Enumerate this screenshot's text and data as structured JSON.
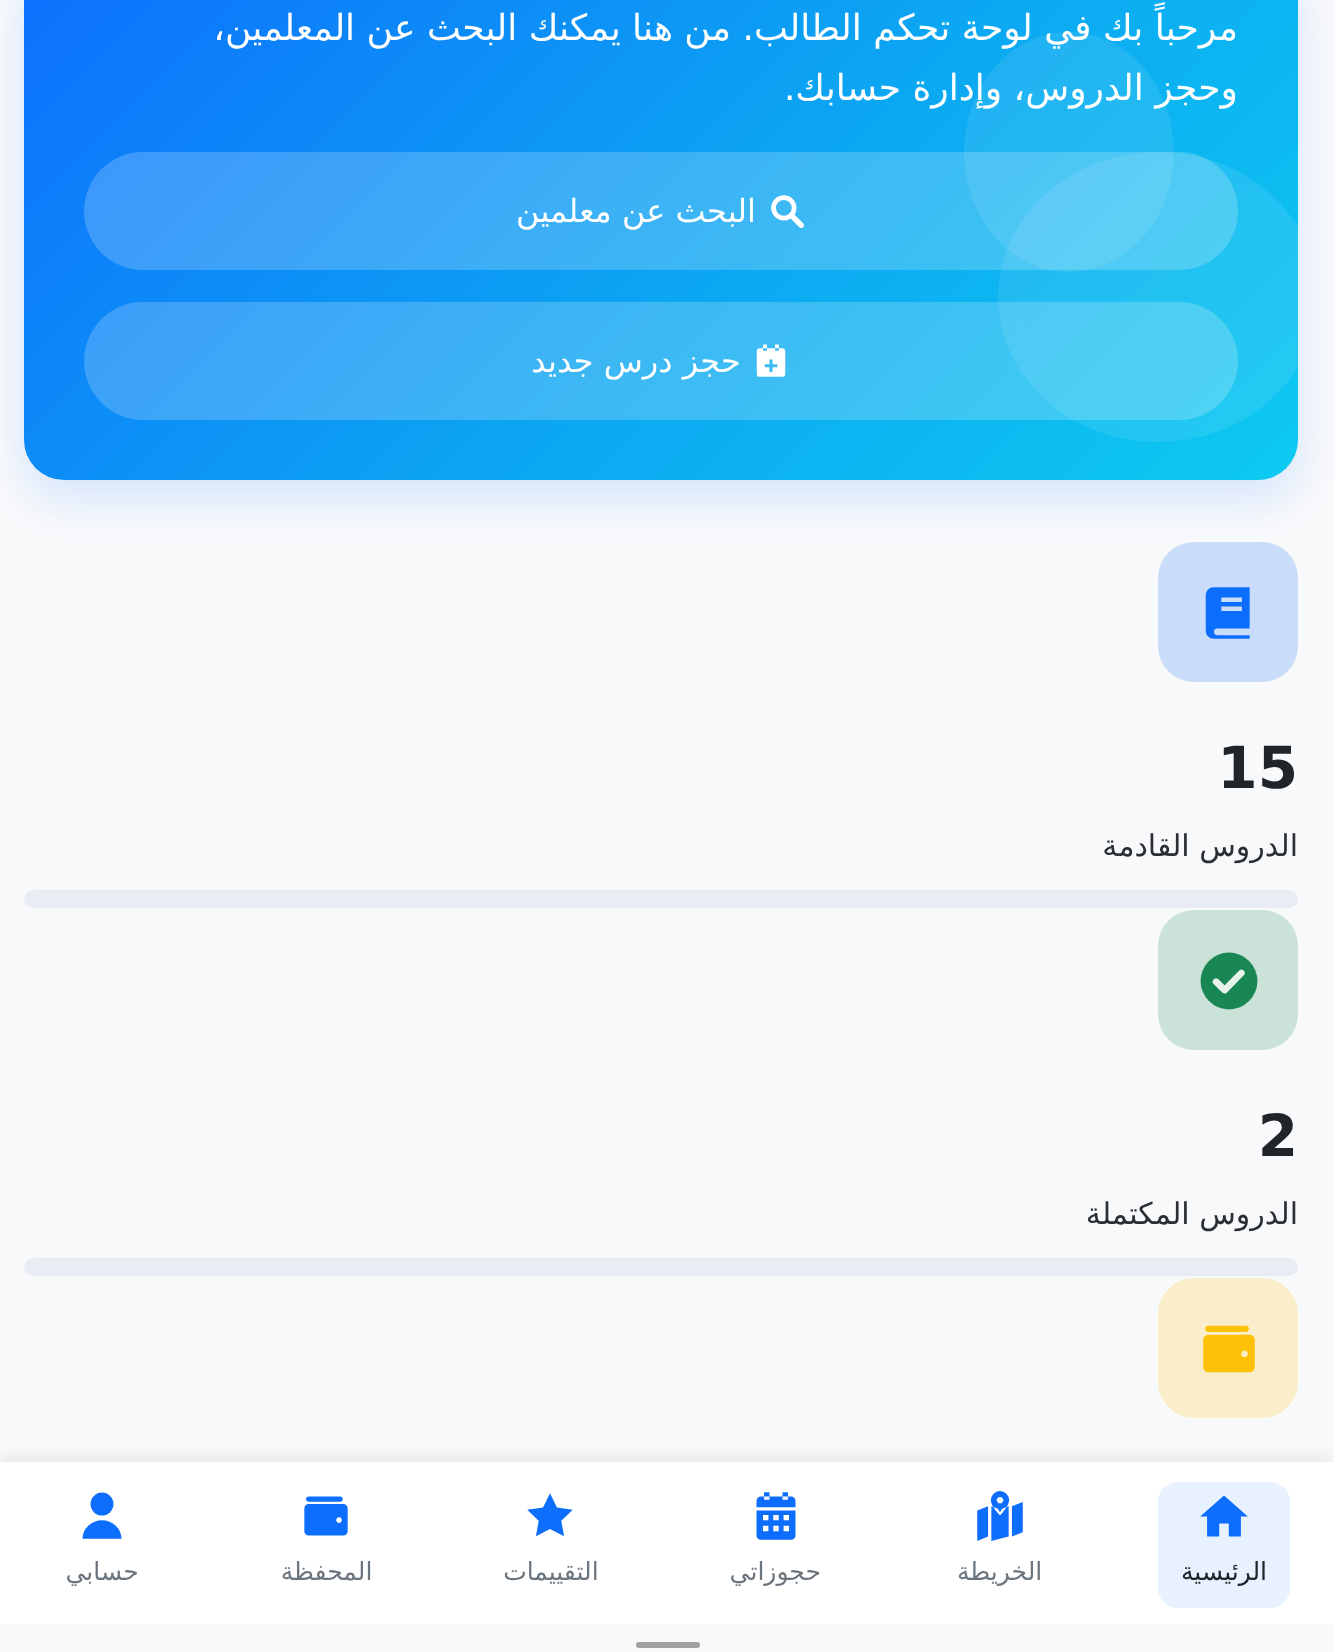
{
  "hero": {
    "welcome_text": "مرحباً بك في لوحة تحكم الطالب. من هنا يمكنك البحث عن المعلمين، وحجز الدروس، وإدارة حسابك.",
    "buttons": [
      {
        "kind": "search",
        "label": "البحث عن معلمين"
      },
      {
        "kind": "booking",
        "label": "حجز درس جديد"
      }
    ]
  },
  "stats": [
    {
      "kind": "book",
      "color": "#0d6efd",
      "value": "15",
      "label": "الدروس القادمة"
    },
    {
      "kind": "check",
      "color": "#198754",
      "value": "2",
      "label": "الدروس المكتملة"
    },
    {
      "kind": "wallet",
      "color": "#ffc107"
    }
  ],
  "bottom_nav": [
    {
      "kind": "home",
      "label": "الرئيسية",
      "selected": true
    },
    {
      "kind": "map",
      "label": "الخريطة",
      "selected": false
    },
    {
      "kind": "calendar",
      "label": "حجوزاتي",
      "selected": false
    },
    {
      "kind": "star",
      "label": "التقييمات",
      "selected": false
    },
    {
      "kind": "wallet",
      "label": "المحفظة",
      "selected": false
    },
    {
      "kind": "user",
      "label": "حسابي",
      "selected": false
    }
  ]
}
